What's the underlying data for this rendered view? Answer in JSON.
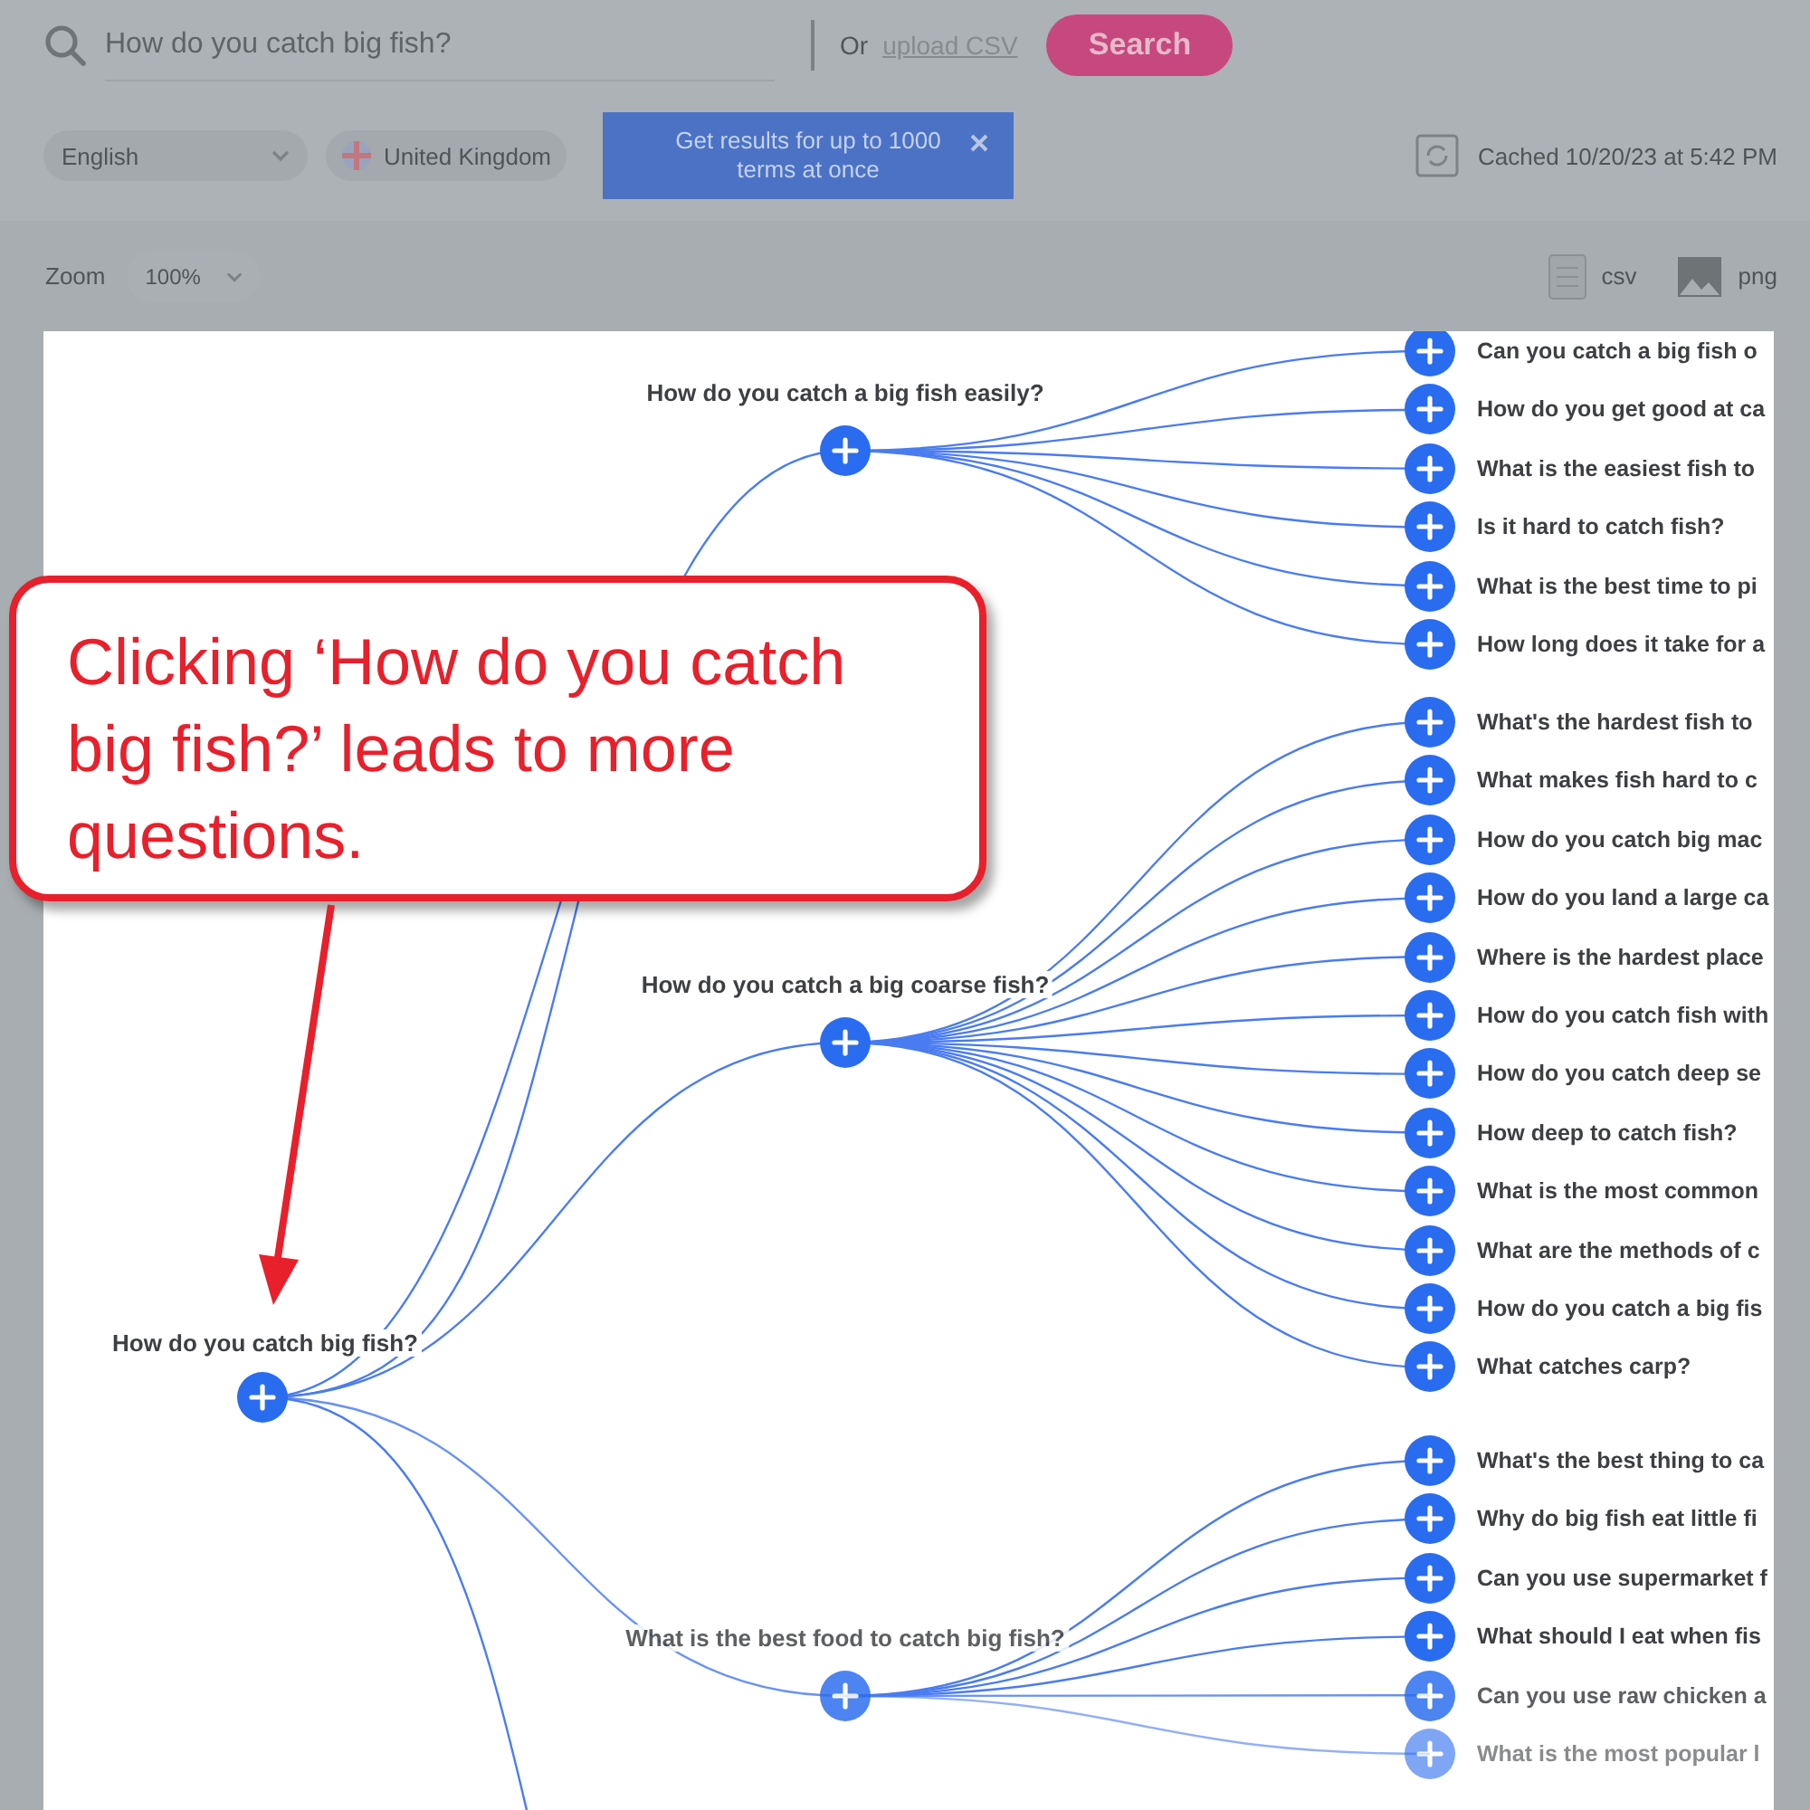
{
  "search": {
    "value": "How do you catch big fish?",
    "or_text": "Or",
    "upload_link": "upload CSV",
    "button": "Search"
  },
  "filters": {
    "language": "English",
    "country": "United Kingdom"
  },
  "tooltip": {
    "text": "Get results for up to 1000 terms at once"
  },
  "cached": "Cached 10/20/23 at 5:42 PM",
  "zoom": {
    "label": "Zoom",
    "value": "100%"
  },
  "exports": [
    {
      "kind": "csv",
      "label": "csv"
    },
    {
      "kind": "png",
      "label": "png"
    }
  ],
  "tree": {
    "label": "How do you catch big fish?",
    "children": [
      {
        "label": "How do you catch a big fish easily?",
        "children": [
          {
            "label": "Can you catch a big fish o"
          },
          {
            "label": "How do you get good at ca"
          },
          {
            "label": "What is the easiest fish to"
          },
          {
            "label": "Is it hard to catch fish?"
          },
          {
            "label": "What is the best time to pi"
          },
          {
            "label": "How long does it take for a"
          }
        ]
      },
      {
        "label": "How do you catch a big coarse fish?",
        "children": [
          {
            "label": "What's the hardest fish to"
          },
          {
            "label": "What makes fish hard to c"
          },
          {
            "label": "How do you catch big mac"
          },
          {
            "label": "How do you land a large ca"
          },
          {
            "label": "Where is the hardest place"
          },
          {
            "label": "How do you catch fish with"
          },
          {
            "label": "How do you catch deep se"
          },
          {
            "label": "How deep to catch fish?"
          },
          {
            "label": "What is the most common"
          },
          {
            "label": "What are the methods of c"
          },
          {
            "label": "How do you catch a big fis"
          },
          {
            "label": "What catches carp?"
          }
        ]
      },
      {
        "label": "What is the best food to catch big fish?",
        "children": [
          {
            "label": "What's the best thing to ca"
          },
          {
            "label": "Why do big fish eat little fi"
          },
          {
            "label": "Can you use supermarket f"
          },
          {
            "label": "What should I eat when fis"
          },
          {
            "label": "Can you use raw chicken a"
          },
          {
            "label": "What is the most popular l"
          }
        ]
      }
    ]
  },
  "callout": {
    "text": "Clicking ‘How do you catch big fish?’ leads to more questions."
  }
}
